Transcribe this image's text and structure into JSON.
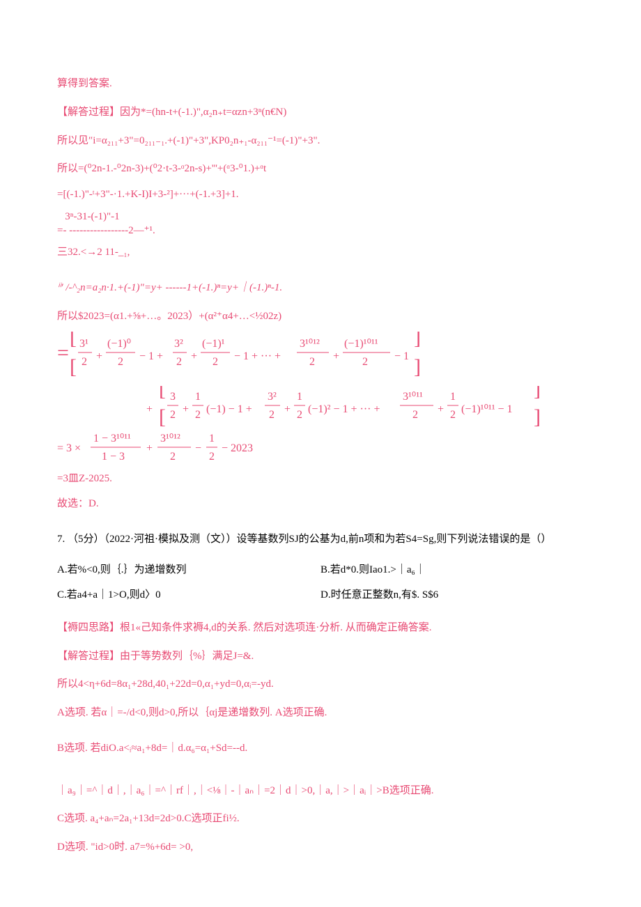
{
  "lines": {
    "l1": "算得到答案.",
    "l2": "【解答过程】因为*=(hn-t+(-1.)\",α₂n₊t=αzn+3ⁿ(n€N)",
    "l3": "所以见″i=α₂₁₁+3\"=0₂₁₁₋₁.+(-1)\"+3\",KP0₂n₊₁-α₂₁₁⁻¹=(-1)\"+3\".",
    "l4": "所以=(⁰2n-1.-⁰2n-3)+(⁰2·t-3-ᵅ2n-s)+'''+(ᵅ3-⁰1.)+ᵅt",
    "l5": "=[(-1.)\"-ᵗ+3\"-·1.+K-I)I+3-²]+···+(-1.+3]+1.",
    "l6a": "   3ⁿ-31-(-1)\"-1",
    "l6b": "=- -----------------2—⁺¹.",
    "l7": "三32.<→2 11-_₁,",
    "l8": "ⁱⁱ′ /-^₂n=a₂n·1.+(-1)\"=y+                ------1+(-1.)ⁿ=y+｜(-1.)ⁿ-1.",
    "l9": "所以$2023=(α1.+⅝+…。2023）+(α²⁺α4+…<½02z)",
    "l10": "=3皿Z-2025.",
    "l11": "故选：D.",
    "q7_stem": "7.  （5分）（2022·河祖·模拟及测（文））设等基数列SJ的公基为d,前n项和为若S4=Sg,则下列说法错误的是（）",
    "q7_A": "A.若%<0,则｛.｝为递增数列",
    "q7_B": "B.若d*0.则Iao1.>｜a₆｜",
    "q7_C": "C.若a4+a｜1>O,则d〉0",
    "q7_D": "D.时任意正整数n,有$. S$6",
    "e1": "【褥四思路】根1«己知条件求褥4,d的关系. 然后对选项连·分析. 从而确定正确答案.",
    "e2": "【解答过程】由于等势数列｛%｝满足J=&.",
    "e3": "所以4<η+6d=8α₁+28d,40₁+22d=0,α₁+yd=0,αᵢ=-yd.",
    "e4": "A选项. 若α｜=-/d<0,则d>0,所以｛αj是递增数列. A选项正确.",
    "e5": "B选项. 若diO.a<ᵢ≈a₁+8d=｜d.α₆=α₁+Sd=--d.",
    "e6": "｜a₉｜=^｜d｜,｜a₆｜=^｜rf｜,｜<⅛｜-｜aₙ｜=2｜d｜>0,｜a,｜>｜aᵢ｜>B选项正确.",
    "e7": "C选项. a₄+aₙ=2a₁+13d=2d>0.C选项正fi½.",
    "e8": "D选项. \"id>0时. a7=%+6d=                    >0,"
  }
}
